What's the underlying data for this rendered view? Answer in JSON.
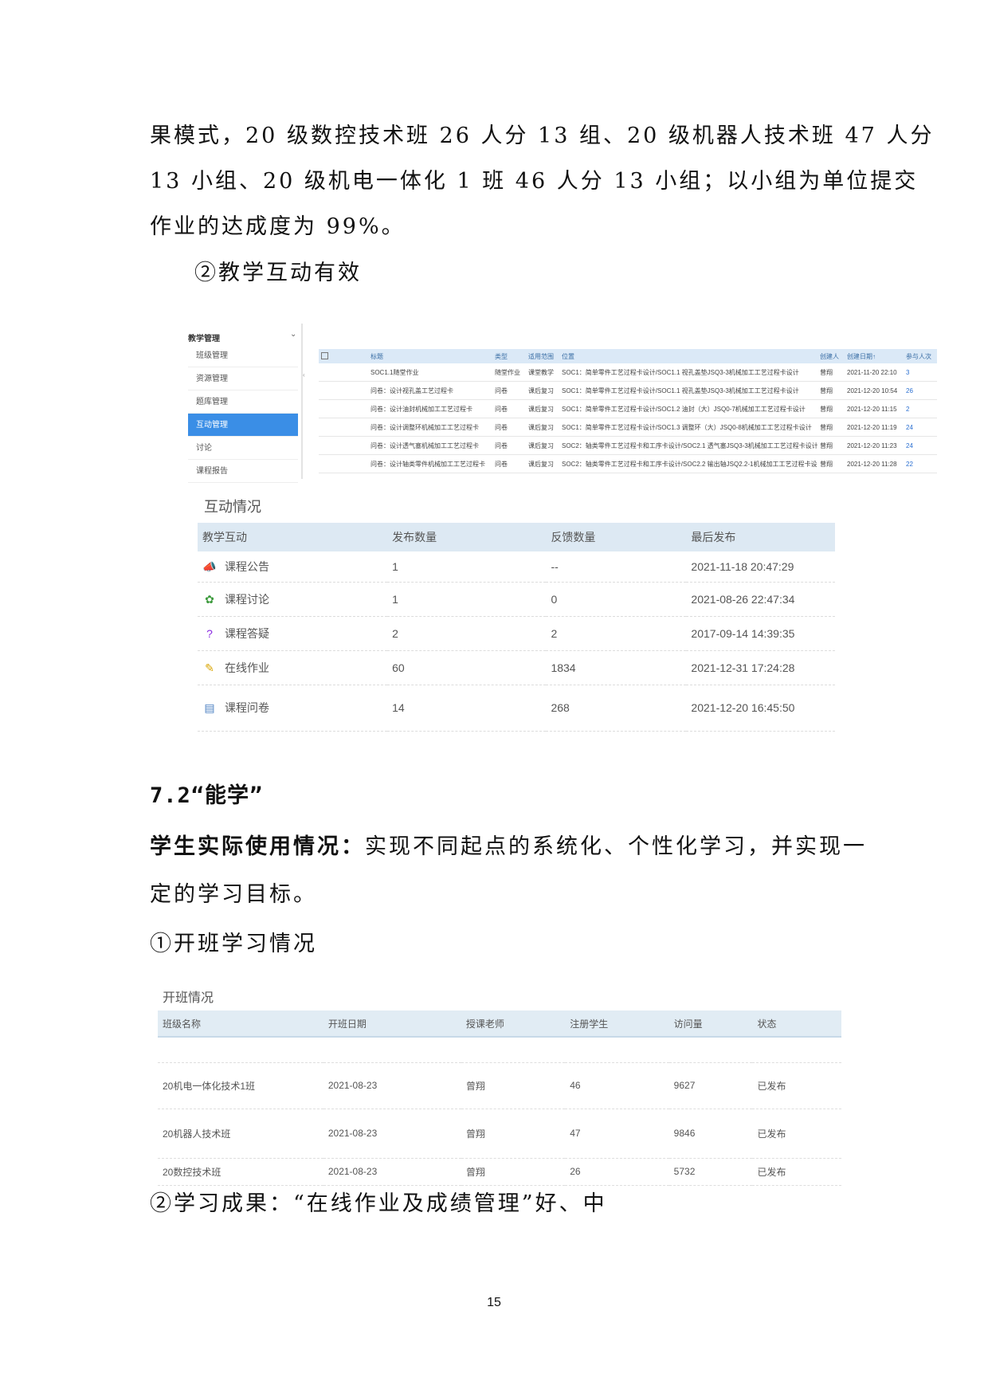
{
  "text": {
    "para1_line1": "果模式，20 级数控技术班 26 人分 13 组、20 级机器人技术班 47 人分",
    "para1_line2": "13 小组、20 级机电一体化 1 班 46 人分 13 小组；以小组为单位提交",
    "para1_line3": "作业的达成度为 99%。",
    "sub_heading_2": "②教学互动有效",
    "section_heading": "7.2“能学”",
    "student_bold": "学生实际使用情况：",
    "student_rest": "实现不同起点的系统化、个性化学习，并实现一",
    "student_line2": "定的学习目标。",
    "sub_heading_open": "①开班学习情况",
    "sub_heading_result": "②学习成果：“在线作业及成绩管理”好、中",
    "page_number": "15"
  },
  "admin_screen": {
    "sidebar_title": "教学管理",
    "sidebar_items": [
      {
        "label": "班级管理",
        "active": false
      },
      {
        "label": "资源管理",
        "active": false
      },
      {
        "label": "题库管理",
        "active": false
      },
      {
        "label": "互动管理",
        "active": true
      },
      {
        "label": "讨论",
        "active": false
      },
      {
        "label": "课程报告",
        "active": false
      }
    ],
    "columns": [
      "标题",
      "类型",
      "适用范围",
      "位置",
      "创建人",
      "创建日期↑",
      "参与人次"
    ],
    "rows": [
      [
        "SOC1.1随堂作业",
        "随堂作业",
        "课堂教学",
        "SOC1：简单零件工艺过程卡设计/SOC1.1 视孔盖垫JSQ3-3机械加工工艺过程卡设计",
        "曾翔",
        "2021-11-20 22:10",
        "3"
      ],
      [
        "问卷：设计视孔盖工艺过程卡",
        "问卷",
        "课后复习",
        "SOC1：简单零件工艺过程卡设计/SOC1.1 视孔盖垫JSQ3-3机械加工工艺过程卡设计",
        "曾翔",
        "2021-12-20 10:54",
        "26"
      ],
      [
        "问卷：设计油封机械加工工艺过程卡",
        "问卷",
        "课后复习",
        "SOC1：简单零件工艺过程卡设计/SOC1.2 油封（大）JSQ0-7机械加工工艺过程卡设计",
        "曾翔",
        "2021-12-20 11:15",
        "2"
      ],
      [
        "问卷：设计调整环机械加工工艺过程卡",
        "问卷",
        "课后复习",
        "SOC1：简单零件工艺过程卡设计/SOC1.3 调整环（大）JSQ0-8机械加工工艺过程卡设计",
        "曾翔",
        "2021-12-20 11:19",
        "24"
      ],
      [
        "问卷：设计透气塞机械加工工艺过程卡",
        "问卷",
        "课后复习",
        "SOC2：轴类零件工艺过程卡和工序卡设计/SOC2.1 透气塞JSQ3-3机械加工工艺过程卡设计",
        "曾翔",
        "2021-12-20 11:23",
        "24"
      ],
      [
        "问卷：设计轴类零件机械加工工艺过程卡",
        "问卷",
        "课后复习",
        "SOC2：轴类零件工艺过程卡和工序卡设计/SOC2.2 输出轴JSQ2.2-1机械加工工艺过程卡设计",
        "曾翔",
        "2021-12-20 11:28",
        "22"
      ]
    ]
  },
  "interaction": {
    "title": "互动情况",
    "columns": [
      "教学互动",
      "发布数量",
      "反馈数量",
      "最后发布"
    ],
    "rows": [
      {
        "icon": "announcement-icon",
        "glyph": "📣",
        "color": "#c89a2a",
        "name": "课程公告",
        "published": "1",
        "feedback": "--",
        "last": "2021-11-18 20:47:29"
      },
      {
        "icon": "discussion-icon",
        "glyph": "✿",
        "color": "#3c9a3c",
        "name": "课程讨论",
        "published": "1",
        "feedback": "0",
        "last": "2021-08-26 22:47:34"
      },
      {
        "icon": "question-icon",
        "glyph": "?",
        "color": "#8a2be2",
        "name": "课程答疑",
        "published": "2",
        "feedback": "2",
        "last": "2017-09-14 14:39:35"
      },
      {
        "icon": "pencil-icon",
        "glyph": "✎",
        "color": "#d9a400",
        "name": "在线作业",
        "published": "60",
        "feedback": "1834",
        "last": "2021-12-31 17:24:28"
      },
      {
        "icon": "document-icon",
        "glyph": "▤",
        "color": "#4a7fc1",
        "name": "课程问卷",
        "published": "14",
        "feedback": "268",
        "last": "2021-12-20 16:45:50"
      }
    ]
  },
  "classes": {
    "title": "开班情况",
    "columns": [
      "班级名称",
      "开班日期",
      "授课老师",
      "注册学生",
      "访问量",
      "状态"
    ],
    "rows": [
      [
        "20机电一体化技术1班",
        "2021-08-23",
        "曾翔",
        "46",
        "9627",
        "已发布"
      ],
      [
        "20机器人技术班",
        "2021-08-23",
        "曾翔",
        "47",
        "9846",
        "已发布"
      ],
      [
        "20数控技术班",
        "2021-08-23",
        "曾翔",
        "26",
        "5732",
        "已发布"
      ]
    ]
  }
}
